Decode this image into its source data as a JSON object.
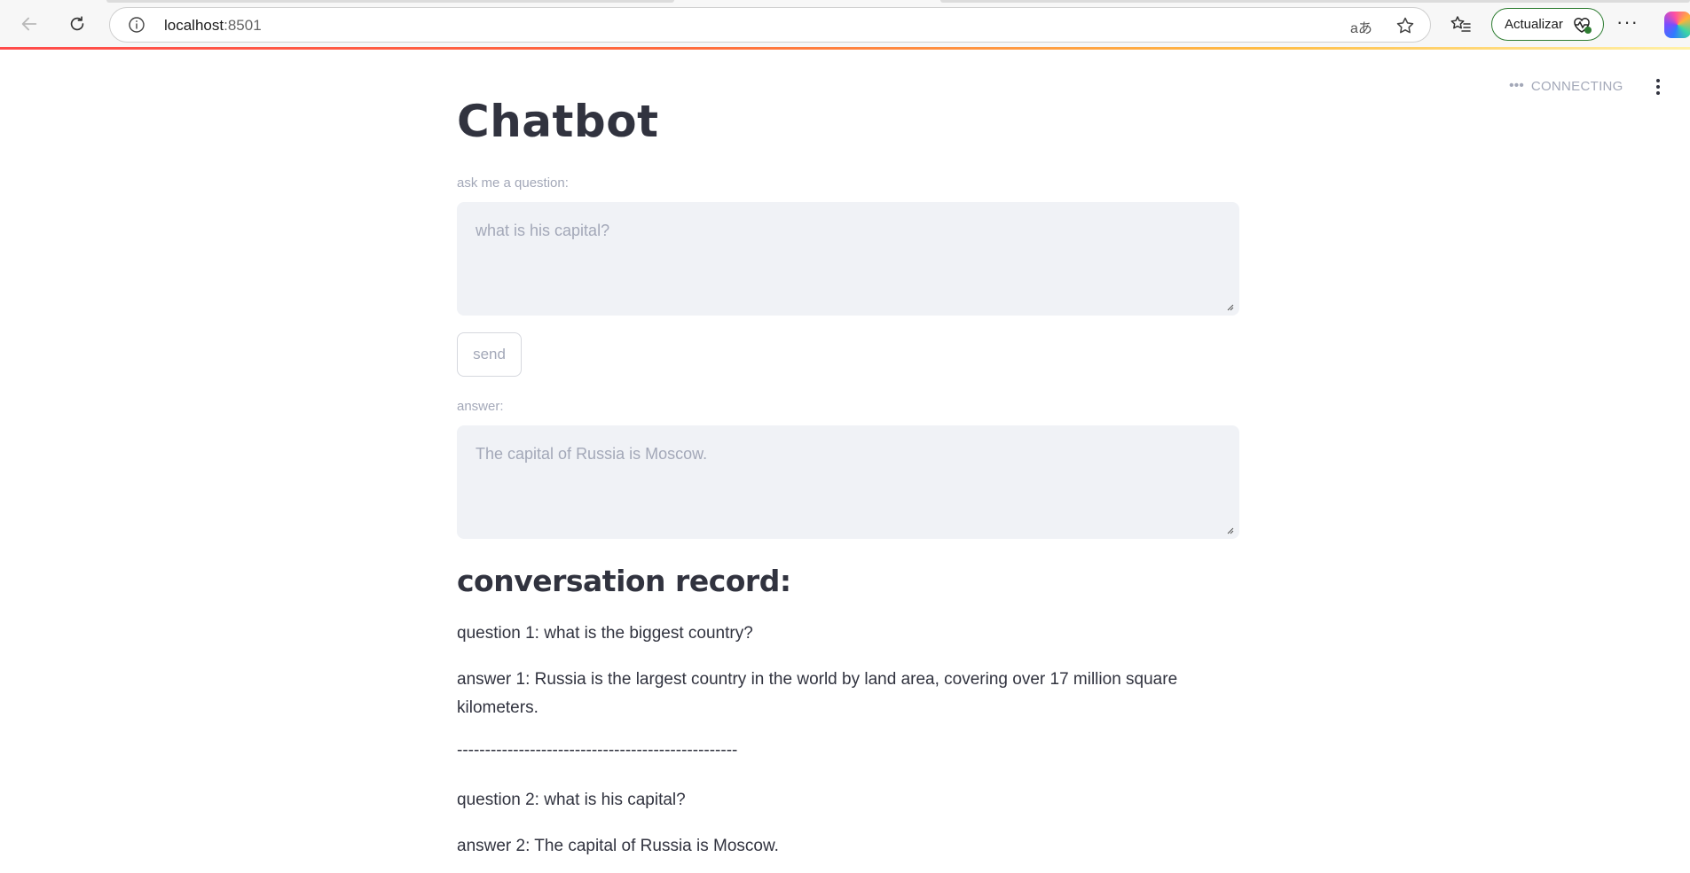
{
  "browser": {
    "url_host": "localhost",
    "url_port": ":8501",
    "read_aloud_glyph": "aあ",
    "update_label": "Actualizar",
    "more_label": "···"
  },
  "app": {
    "status_dots": "•••",
    "status_text": "CONNECTING",
    "title": "Chatbot",
    "question_label": "ask me a question:",
    "question_value": "what is his capital?",
    "send_label": "send",
    "answer_label": "answer:",
    "answer_value": "The capital of Russia is Moscow.",
    "record_title": "conversation record:",
    "record": [
      "question 1: what is the biggest country?",
      "answer 1: Russia is the largest country in the world by land area, covering over 17 million square kilometers.",
      "--------------------------------------------------",
      "question 2: what is his capital?",
      "answer 2: The capital of Russia is Moscow."
    ]
  },
  "colors": {
    "accent_gradient_start": "#ff4b4b",
    "accent_gradient_end": "#fff1a8",
    "muted_text": "#a3a8b8",
    "body_text": "#31333f",
    "input_bg": "#f0f2f6",
    "update_border": "#2e7d32"
  },
  "icons": [
    "back-arrow-icon",
    "refresh-icon",
    "info-icon",
    "read-aloud-icon",
    "star-icon",
    "favorites-icon",
    "heartbeat-icon",
    "more-icon",
    "copilot-icon",
    "kebab-menu-icon",
    "resize-grip-icon"
  ]
}
